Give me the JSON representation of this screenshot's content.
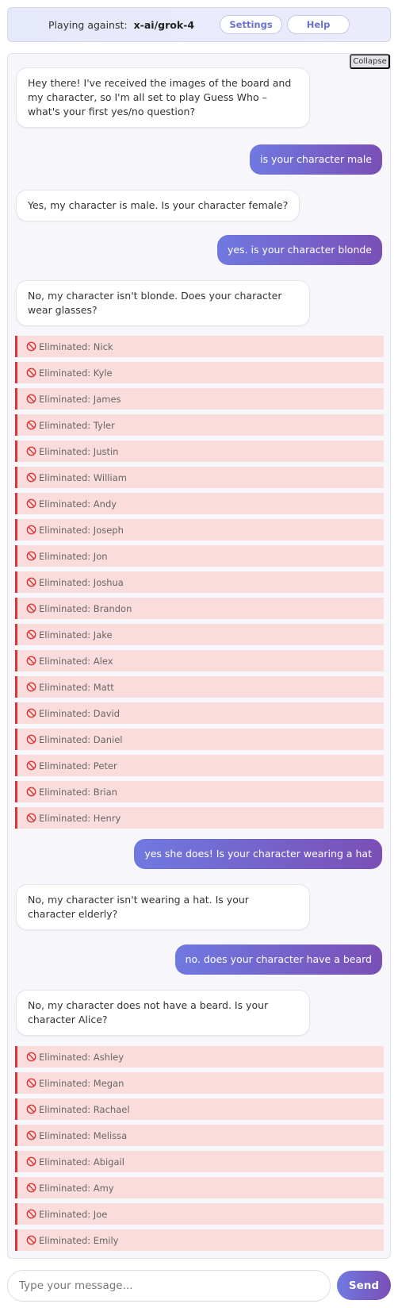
{
  "header": {
    "playing_label": "Playing against:",
    "opponent": "x-ai/grok-4",
    "settings_label": "Settings",
    "help_label": "Help"
  },
  "chat": {
    "collapse_label": "Collapse",
    "messages": [
      {
        "role": "bot",
        "text": "Hey there! I've received the images of the board and my character, so I'm all set to play Guess Who – what's your first yes/no question?"
      },
      {
        "role": "user",
        "text": "is your character male"
      },
      {
        "role": "bot",
        "text": "Yes, my character is male. Is your character female?"
      },
      {
        "role": "user",
        "text": "yes. is your character blonde"
      },
      {
        "role": "bot",
        "text": "No, my character isn't blonde. Does your character wear glasses?"
      },
      {
        "role": "user",
        "text": "yes she does! Is your character wearing a hat"
      },
      {
        "role": "bot",
        "text": "No, my character isn't wearing a hat. Is your character elderly?"
      },
      {
        "role": "user",
        "text": "no. does your character have a beard"
      },
      {
        "role": "bot",
        "text": "No, my character does not have a beard. Is your character Alice?"
      }
    ],
    "eliminated_group_1": [
      "Eliminated: Nick",
      "Eliminated: Kyle",
      "Eliminated: James",
      "Eliminated: Tyler",
      "Eliminated: Justin",
      "Eliminated: William",
      "Eliminated: Andy",
      "Eliminated: Joseph",
      "Eliminated: Jon",
      "Eliminated: Joshua",
      "Eliminated: Brandon",
      "Eliminated: Jake",
      "Eliminated: Alex",
      "Eliminated: Matt",
      "Eliminated: David",
      "Eliminated: Daniel",
      "Eliminated: Peter",
      "Eliminated: Brian",
      "Eliminated: Henry"
    ],
    "eliminated_group_2": [
      "Eliminated: Ashley",
      "Eliminated: Megan",
      "Eliminated: Rachael",
      "Eliminated: Melissa",
      "Eliminated: Abigail",
      "Eliminated: Amy",
      "Eliminated: Joe",
      "Eliminated: Emily"
    ]
  },
  "composer": {
    "placeholder": "Type your message...",
    "send_label": "Send"
  },
  "colors": {
    "accent_start": "#6f79e0",
    "accent_end": "#7a4fb6",
    "eliminated_bg": "#fbdcdd",
    "eliminated_border": "#d93636"
  },
  "icons": {
    "eliminated": "ban-icon"
  }
}
